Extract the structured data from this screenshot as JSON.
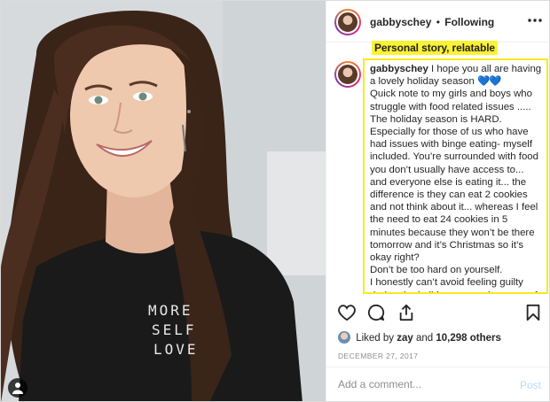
{
  "post": {
    "username": "gabbyschey",
    "separator": "•",
    "follow_status": "Following",
    "annotation": "Personal story, relatable",
    "caption_text": "I hope you all are having a lovely holiday season",
    "caption_hearts": "💙💙",
    "caption_lines": [
      "Quick note to my girls and boys who struggle with food related issues .....",
      "The holiday season is HARD. Especially for those of us who have had issues with binge eating- myself included. You’re surrounded with food you don’t usually have access to... and everyone else is eating it... the difference is they can eat 2 cookies and not think about it... whereas I feel the need to eat 24 cookies in 5 minutes because they won’t be there tomorrow and it’s Christmas so it’s okay right?",
      "Don’t be too hard on yourself.",
      "I honestly can’t avoid feeling guilty during the holiday season because of how “bad” my diet gets... It’s so hard. I"
    ],
    "shirt_text": [
      "MORE",
      "SELF",
      "LOVE"
    ],
    "likes": {
      "prefix": "Liked by",
      "user": "zay",
      "joiner": "and",
      "count": "10,298 others"
    },
    "date": "DECEMBER 27, 2017",
    "comment_placeholder": "Add a comment...",
    "post_label": "Post"
  }
}
